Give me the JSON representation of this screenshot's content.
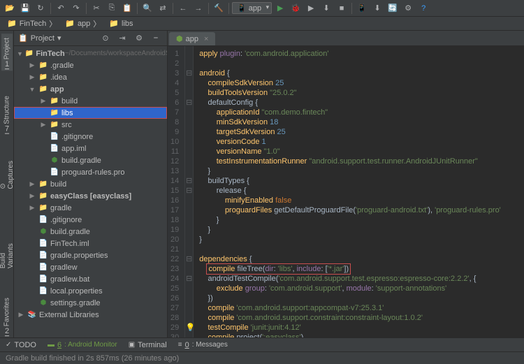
{
  "toolbar": {
    "dropdown": "app"
  },
  "nav": {
    "project": "FinTech",
    "module": "app",
    "folder": "libs"
  },
  "panel": {
    "title": "Project"
  },
  "tree": {
    "root": {
      "name": "FinTech",
      "path": "~/Documents/workspaceAndroidStudio/FinT"
    },
    "gradle_dir": ".gradle",
    "idea_dir": ".idea",
    "app": "app",
    "build": "build",
    "libs": "libs",
    "src": "src",
    "gitignore": ".gitignore",
    "app_iml": "app.iml",
    "build_gradle": "build.gradle",
    "proguard": "proguard-rules.pro",
    "build2": "build",
    "easyclass": "easyClass [easyclass]",
    "gradle": "gradle",
    "gitignore2": ".gitignore",
    "build_gradle2": "build.gradle",
    "fintech_iml": "FinTech.iml",
    "gradle_props": "gradle.properties",
    "gradlew": "gradlew",
    "gradlew_bat": "gradlew.bat",
    "local_props": "local.properties",
    "settings_gradle": "settings.gradle",
    "ext_lib": "External Libraries"
  },
  "tab": {
    "name": "app"
  },
  "code": {
    "l1": "apply plugin: 'com.android.application'",
    "l3": "android {",
    "l4": "    compileSdkVersion 25",
    "l5": "    buildToolsVersion \"25.0.2\"",
    "l6": "    defaultConfig {",
    "l7": "        applicationId \"com.demo.fintech\"",
    "l8": "        minSdkVersion 18",
    "l9": "        targetSdkVersion 25",
    "l10": "        versionCode 1",
    "l11": "        versionName \"1.0\"",
    "l12": "        testInstrumentationRunner \"android.support.test.runner.AndroidJUnitRunner\"",
    "l13": "    }",
    "l14": "    buildTypes {",
    "l15": "        release {",
    "l16": "            minifyEnabled false",
    "l17": "            proguardFiles getDefaultProguardFile('proguard-android.txt'), 'proguard-rules.pro'",
    "l18": "        }",
    "l19": "    }",
    "l20": "}",
    "l22": "dependencies {",
    "l23": "    compile fileTree(dir: 'libs', include: ['*.jar'])",
    "l24": "    androidTestCompile('com.android.support.test.espresso:espresso-core:2.2.2', {",
    "l25": "        exclude group: 'com.android.support', module: 'support-annotations'",
    "l26": "    })",
    "l27": "    compile 'com.android.support:appcompat-v7:25.3.1'",
    "l28": "    compile 'com.android.support.constraint:constraint-layout:1.0.2'",
    "l29": "    testCompile 'junit:junit:4.12'",
    "l30": "    compile project(':easyclass')",
    "l32": "}"
  },
  "bottom": {
    "todo": "TODO",
    "android": "6: Android Monitor",
    "terminal": "Terminal",
    "messages": "0: Messages"
  },
  "status": {
    "msg": "Gradle build finished in 2s 857ms (26 minutes ago)"
  }
}
